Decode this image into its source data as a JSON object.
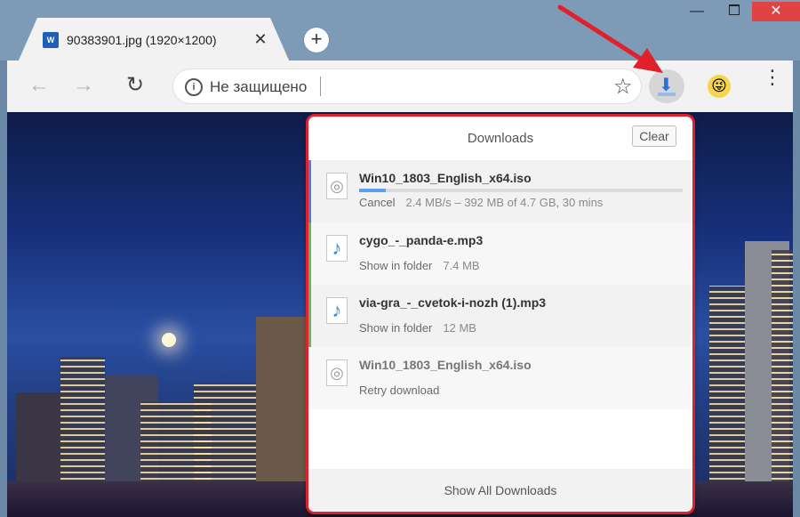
{
  "colors": {
    "accent_red": "#e0202a",
    "download_blue": "#2b6fd6",
    "active_stripe": "#4a7fd8",
    "complete_stripe": "#5cb85c",
    "failed_stripe": "#bdbdbd"
  },
  "tab": {
    "favicon": "W",
    "title": "90383901.jpg (1920×1200)",
    "close_glyph": "✕",
    "new_tab_glyph": "+"
  },
  "window": {
    "minimize_glyph": "—",
    "close_glyph": "✕"
  },
  "toolbar": {
    "back_glyph": "←",
    "forward_glyph": "→",
    "reload_glyph": "↻",
    "info_glyph": "i",
    "omnibox_text": "Не защищено",
    "star_glyph": "☆",
    "download_glyph": "⬇",
    "avatar_glyph": "😜",
    "menu_glyph": "⋮"
  },
  "downloads": {
    "title": "Downloads",
    "clear_label": "Clear",
    "items": [
      {
        "name": "Win10_1803_English_x64.iso",
        "status": "in-progress",
        "progress": 0.083,
        "action": "Cancel",
        "detail": "2.4 MB/s – 392 MB of 4.7 GB, 30 mins",
        "icon": "disc-file-icon",
        "icon_glyph": "◎"
      },
      {
        "name": "cygo_-_panda-e.mp3",
        "status": "complete",
        "action": "Show in folder",
        "detail": "7.4 MB",
        "icon": "music-file-icon",
        "icon_glyph": "♪"
      },
      {
        "name": "via-gra_-_cvetok-i-nozh (1).mp3",
        "status": "complete",
        "action": "Show in folder",
        "detail": "12 MB",
        "icon": "music-file-icon",
        "icon_glyph": "♪"
      },
      {
        "name": "Win10_1803_English_x64.iso",
        "status": "failed",
        "action": "Retry download",
        "detail": "",
        "icon": "disc-file-icon",
        "icon_glyph": "◎"
      }
    ],
    "show_all_label": "Show All Downloads"
  }
}
